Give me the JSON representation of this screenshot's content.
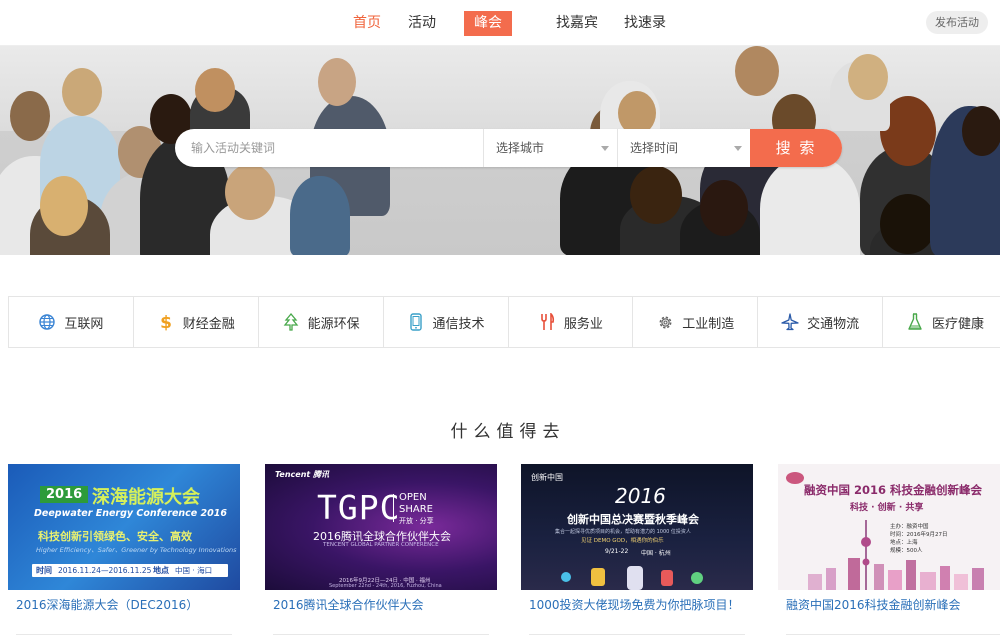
{
  "nav": {
    "items": [
      "首页",
      "活动",
      "峰会",
      "找嘉宾",
      "找速录"
    ],
    "publish": "发布活动"
  },
  "search": {
    "placeholder": "输入活动关键词",
    "city": "选择城市",
    "time": "选择时间",
    "button": "搜 索"
  },
  "categories": [
    {
      "label": "互联网",
      "icon": "globe-icon",
      "color": "#3a84d4"
    },
    {
      "label": "财经金融",
      "icon": "dollar-icon",
      "color": "#f0a020"
    },
    {
      "label": "能源环保",
      "icon": "tree-icon",
      "color": "#48a84a"
    },
    {
      "label": "通信技术",
      "icon": "phone-icon",
      "color": "#3aa0c8"
    },
    {
      "label": "服务业",
      "icon": "cutlery-icon",
      "color": "#e8503a"
    },
    {
      "label": "工业制造",
      "icon": "gear-icon",
      "color": "#666666"
    },
    {
      "label": "交通物流",
      "icon": "plane-icon",
      "color": "#2a5aa8"
    },
    {
      "label": "医疗健康",
      "icon": "flask-icon",
      "color": "#48a84a"
    }
  ],
  "section_title": "什么值得去",
  "cards": [
    {
      "title": "2016深海能源大会（DEC2016）",
      "thumb": {
        "year": "2016",
        "name": "深海能源大会",
        "en": "Deepwater Energy Conference 2016",
        "slogan": "科技创新引领绿色、安全、高效",
        "slogan_en": "Higher Efficiency、Safer、Greener by Technology Innovations",
        "date_label": "时间",
        "date": "2016.11.24—2016.11.25",
        "place_label": "地点",
        "place": "中国 · 海口"
      }
    },
    {
      "title": "2016腾讯全球合作伙伴大会",
      "thumb": {
        "brand": "Tencent 腾讯",
        "logo": "TGPC",
        "open": "OPEN",
        "share": "SHARE",
        "share_cn": "开放 · 分享",
        "name": "2016腾讯全球合作伙伴大会",
        "en": "TENCENT GLOBAL PARTNER CONFERENCE",
        "date": "2016年9月22日—24日 · 中国 · 福州",
        "date_en": "September 22nd - 24th, 2016, Fuzhou, China"
      }
    },
    {
      "title": "1000投资大佬现场免费为你把脉项目！",
      "thumb": {
        "brand": "创新中国",
        "year": "2016",
        "name": "创新中国总决赛暨秋季峰会",
        "desc": "集合一起探寻优质项目的机会，帮助有潜力的 1000 位投资人",
        "demo": "见证 DEMO GOD，相遇你的伯乐",
        "date": "9/21-22",
        "place": "中国 · 杭州"
      }
    },
    {
      "title": "融资中国2016科技金融创新峰会",
      "thumb": {
        "name": "融资中国 2016 科技金融创新峰会",
        "slogan": "科技 · 创新 · 共享",
        "org": "主办：融资中国",
        "time": "时间：2016年9月27日",
        "place": "地点：上海",
        "scale": "规模：500人"
      }
    }
  ]
}
